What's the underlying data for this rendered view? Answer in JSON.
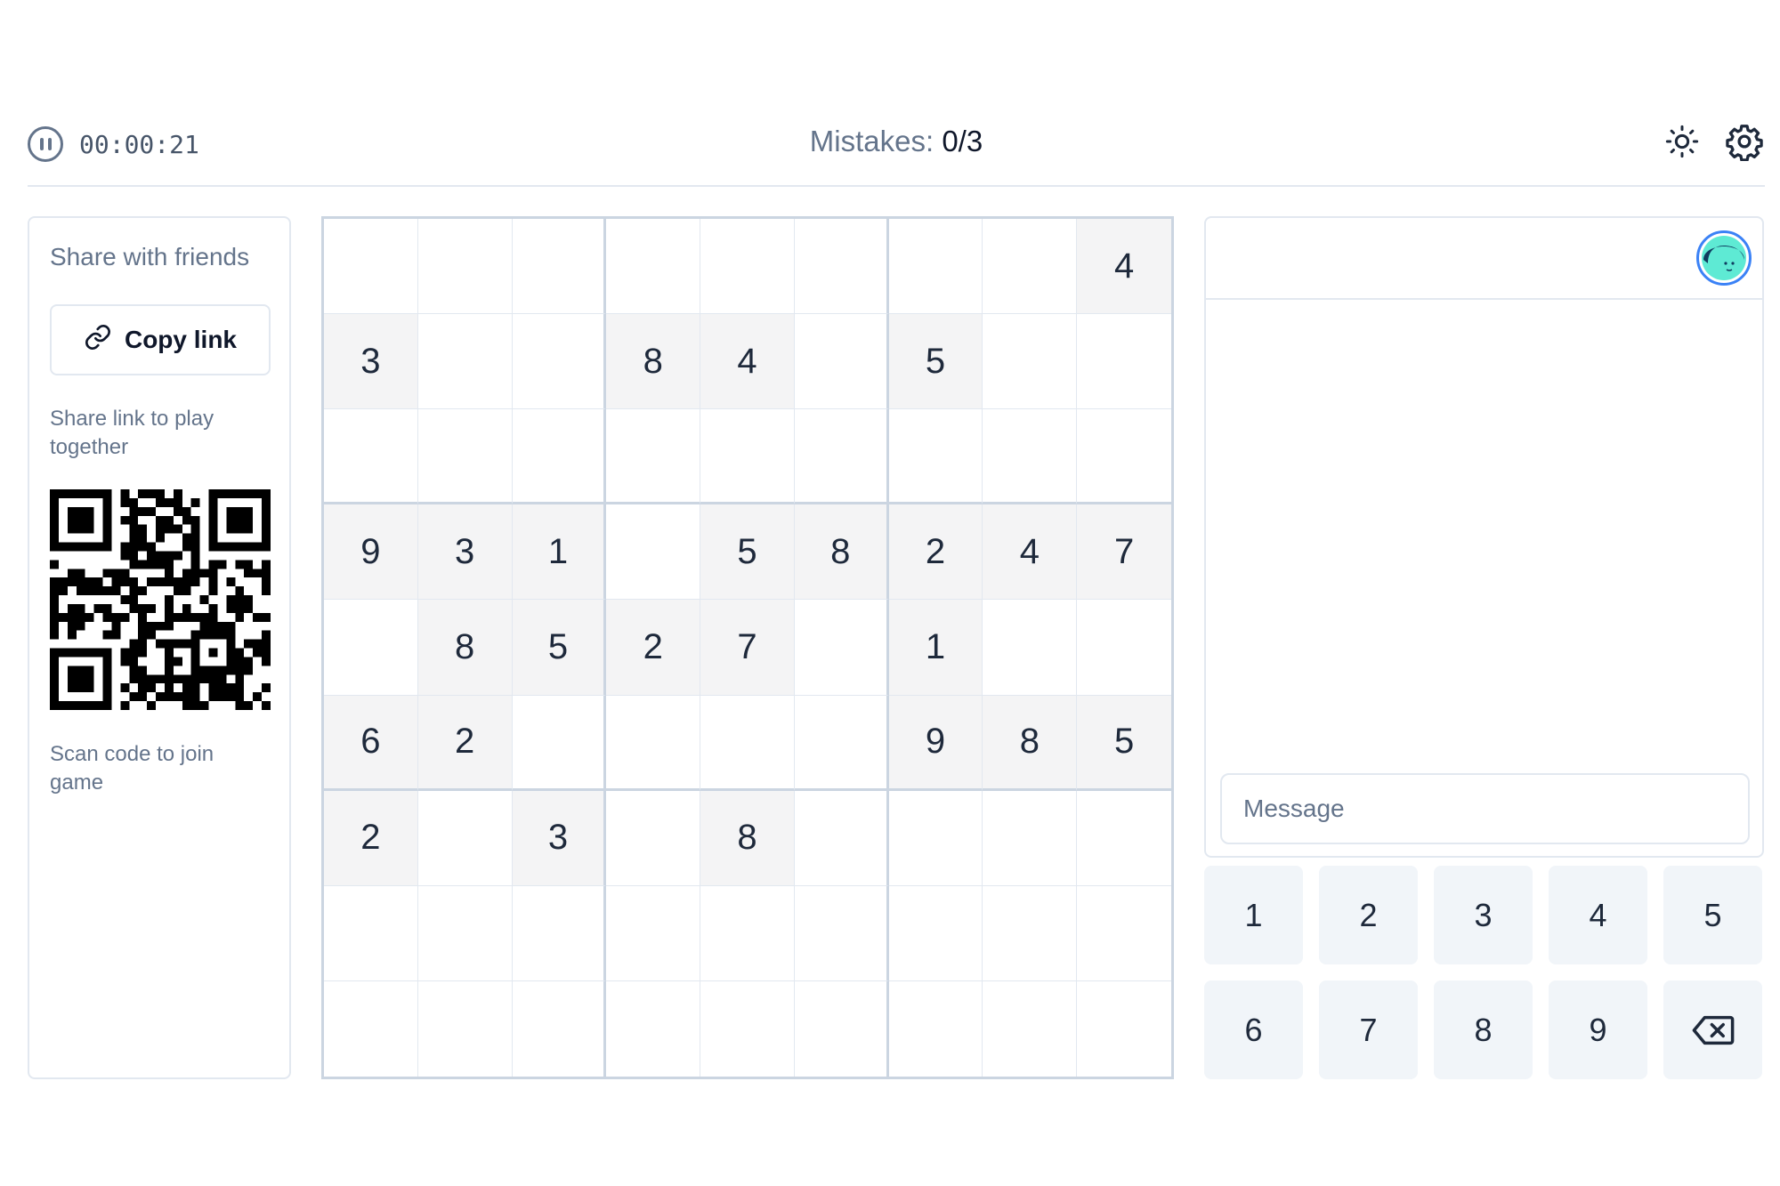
{
  "header": {
    "timer": "00:00:21",
    "mistakes_label": "Mistakes:",
    "mistakes_value": "0/3",
    "icons": [
      "pause-icon",
      "sun-icon",
      "gear-icon"
    ]
  },
  "share": {
    "title": "Share with friends",
    "copy_label": "Copy link",
    "link_hint": "Share link to play together",
    "scan_hint": "Scan code to join game"
  },
  "board": {
    "rows": [
      [
        "",
        "",
        "",
        "",
        "",
        "",
        "",
        "",
        "4"
      ],
      [
        "3",
        "",
        "",
        "8",
        "4",
        "",
        "5",
        "",
        ""
      ],
      [
        "",
        "",
        "",
        "",
        "",
        "",
        "",
        "",
        ""
      ],
      [
        "9",
        "3",
        "1",
        "",
        "5",
        "8",
        "2",
        "4",
        "7"
      ],
      [
        "",
        "8",
        "5",
        "2",
        "7",
        "",
        "1",
        "",
        ""
      ],
      [
        "6",
        "2",
        "",
        "",
        "",
        "",
        "9",
        "8",
        "5"
      ],
      [
        "2",
        "",
        "3",
        "",
        "8",
        "",
        "",
        "",
        ""
      ],
      [
        "",
        "",
        "",
        "",
        "",
        "",
        "",
        "",
        ""
      ],
      [
        "",
        "",
        "",
        "",
        "",
        "",
        "",
        "",
        ""
      ]
    ],
    "shaded": [
      [
        0,
        0,
        0,
        0,
        0,
        0,
        0,
        0,
        1
      ],
      [
        1,
        0,
        0,
        1,
        1,
        0,
        1,
        0,
        0
      ],
      [
        0,
        0,
        0,
        0,
        0,
        0,
        0,
        0,
        0
      ],
      [
        1,
        1,
        1,
        0,
        1,
        1,
        1,
        1,
        1
      ],
      [
        0,
        1,
        1,
        1,
        1,
        0,
        1,
        0,
        0
      ],
      [
        1,
        1,
        0,
        0,
        0,
        0,
        1,
        1,
        1
      ],
      [
        1,
        0,
        1,
        0,
        1,
        0,
        0,
        0,
        0
      ],
      [
        0,
        0,
        0,
        0,
        0,
        0,
        0,
        0,
        0
      ],
      [
        0,
        0,
        0,
        0,
        0,
        0,
        0,
        0,
        0
      ]
    ]
  },
  "chat": {
    "message_placeholder": "Message"
  },
  "numpad": {
    "keys": [
      "1",
      "2",
      "3",
      "4",
      "5",
      "6",
      "7",
      "8",
      "9"
    ],
    "delete_icon": "backspace-icon"
  },
  "colors": {
    "avatar_ring": "#3b82f6",
    "avatar_face": "#5eead4",
    "given_cell": "#f4f4f5",
    "key_bg": "#f1f5f9"
  }
}
